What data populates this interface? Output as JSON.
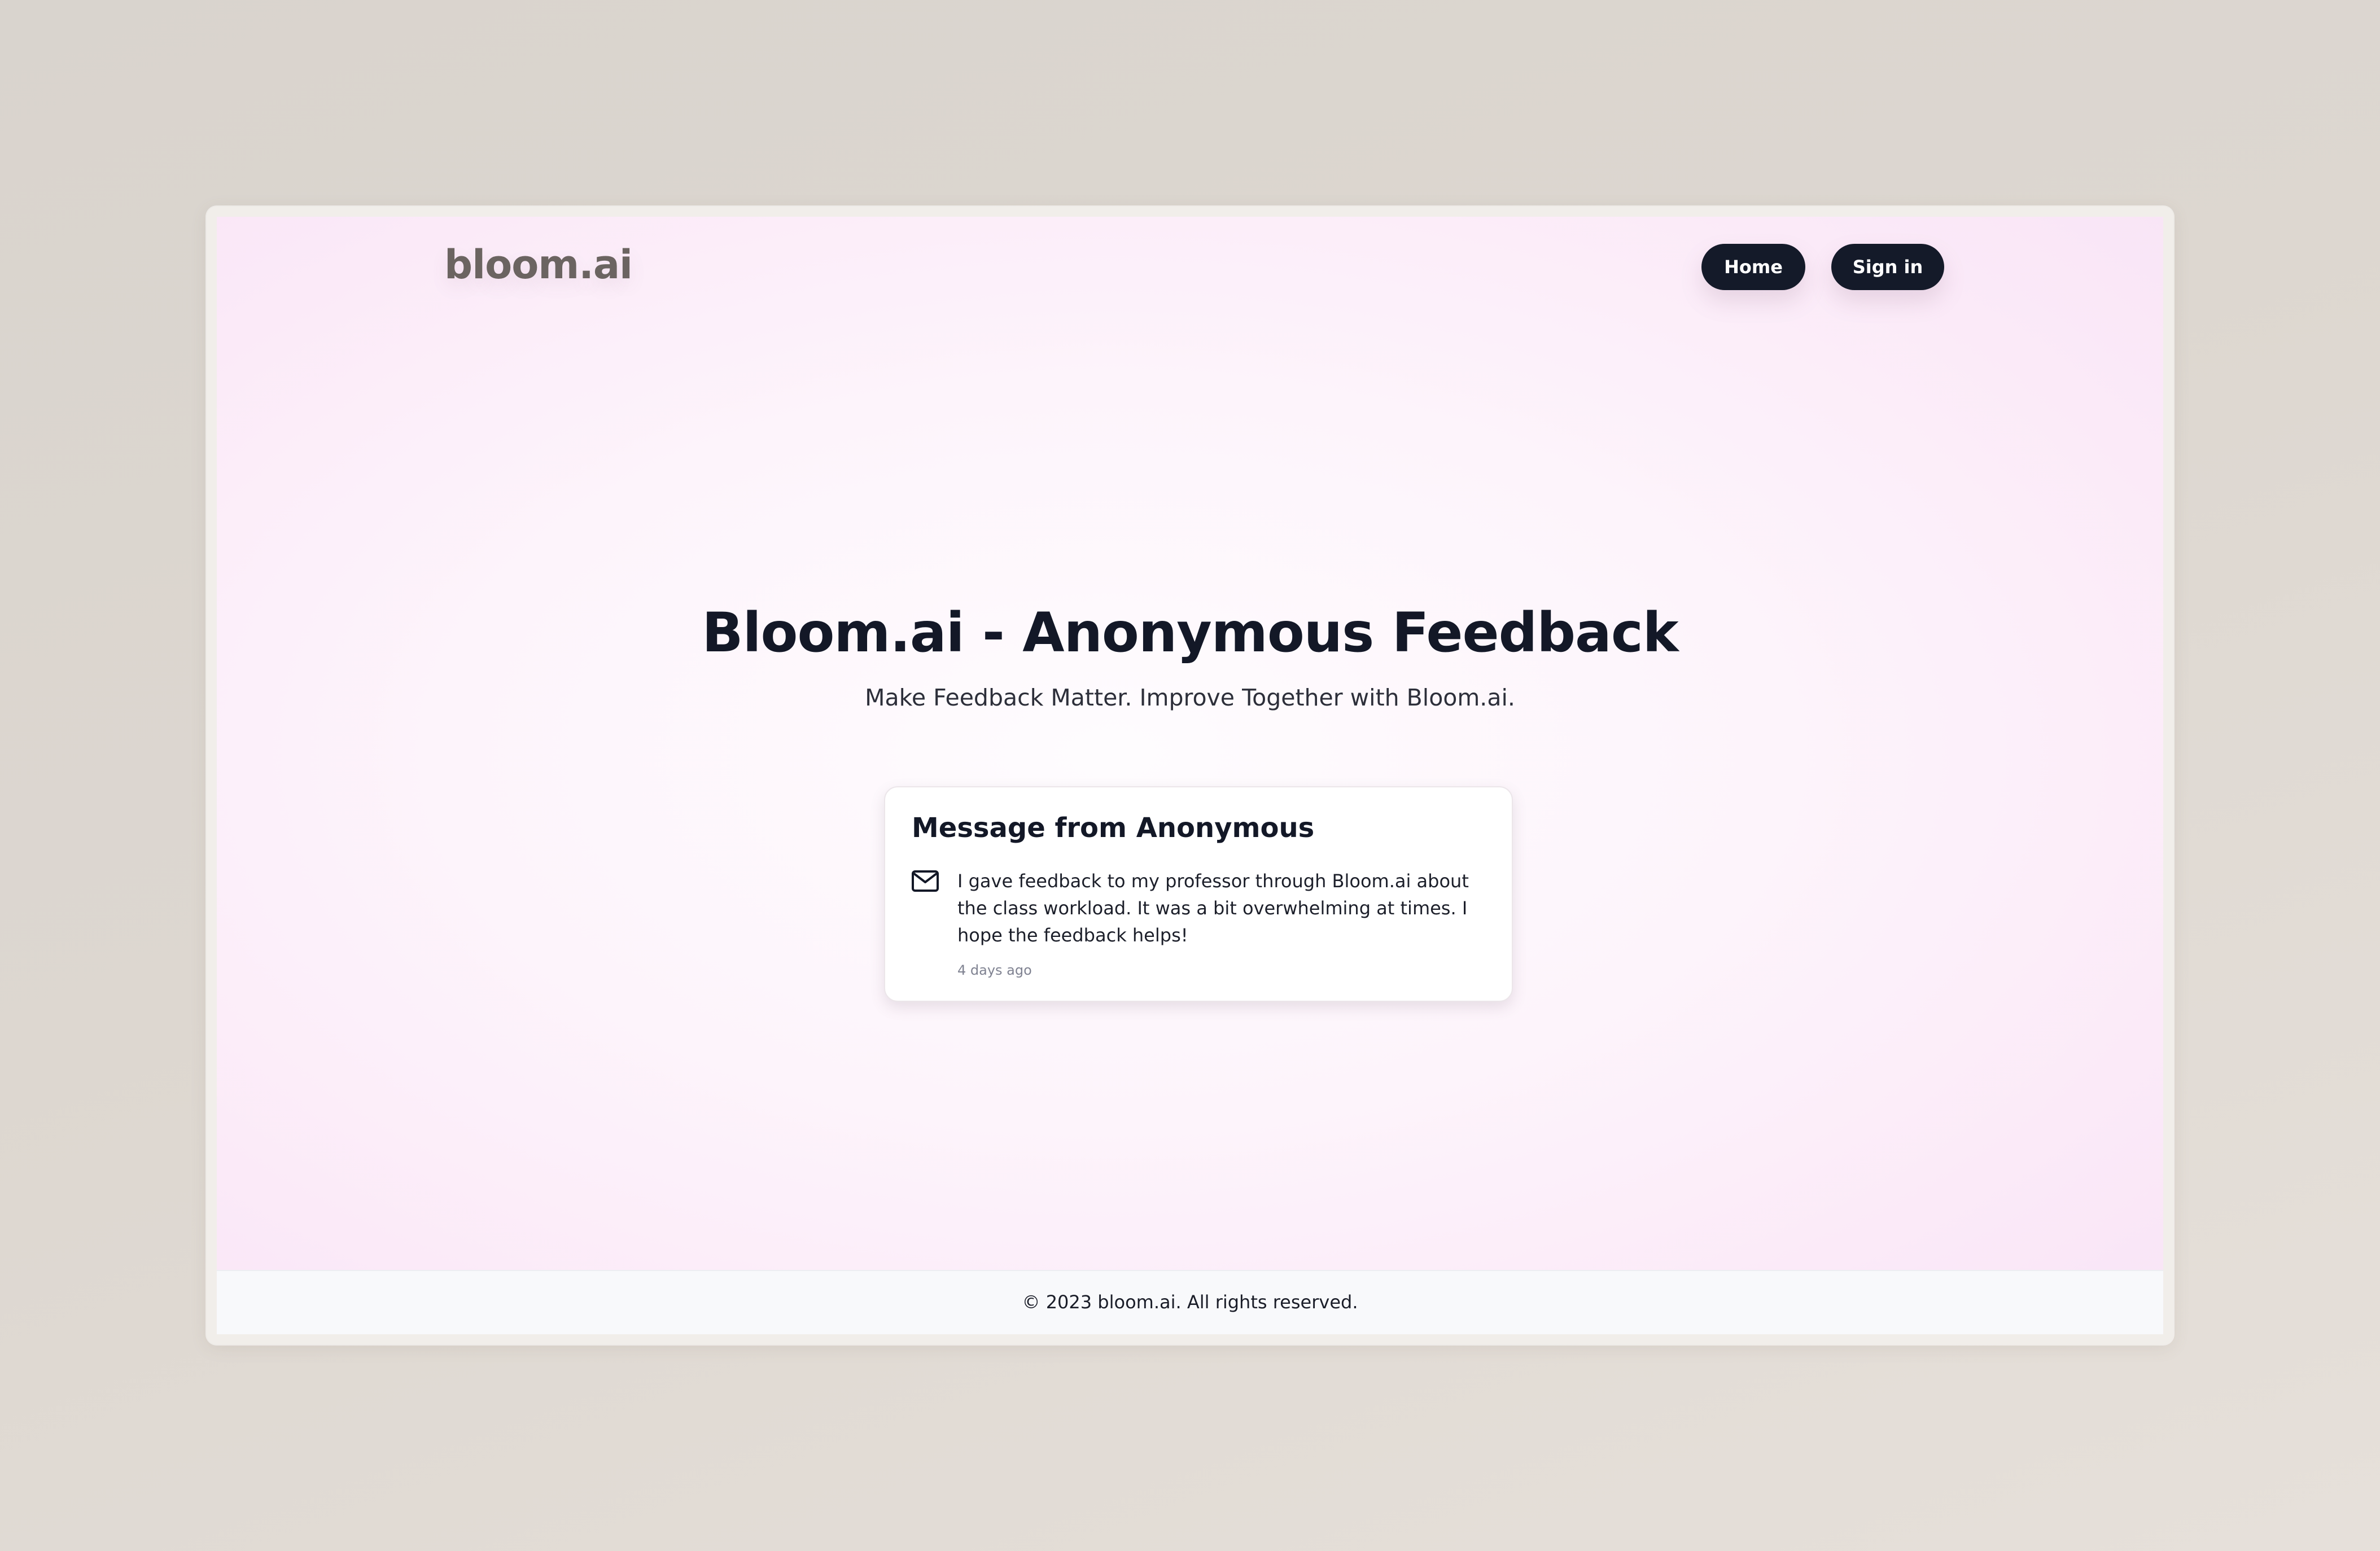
{
  "header": {
    "logo": "bloom.ai",
    "nav": {
      "home_label": "Home",
      "signin_label": "Sign in"
    }
  },
  "hero": {
    "title": "Bloom.ai - Anonymous Feedback",
    "subtitle": "Make Feedback Matter. Improve Together with Bloom.ai."
  },
  "message_card": {
    "title": "Message from Anonymous",
    "icon": "mail-icon",
    "body": "I gave feedback to my professor through Bloom.ai about the class workload. It was a bit overwhelming at times. I hope the feedback helps!",
    "time": "4 days ago"
  },
  "footer": {
    "copyright": "© 2023 bloom.ai. All rights reserved."
  },
  "colors": {
    "accent_dark": "#141a29",
    "background_pink": "#fbeaf8",
    "logo_gray": "#6b6461"
  }
}
